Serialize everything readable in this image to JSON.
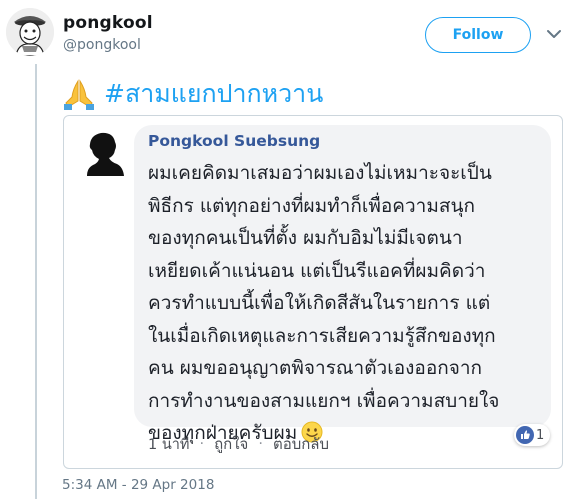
{
  "author": {
    "display_name": "pongkool",
    "handle": "@pongkool"
  },
  "follow_button": {
    "label": "Follow"
  },
  "tweet": {
    "emoji_icon": "folded-hands-icon",
    "hashtag": "#สามแยกปากหวาน"
  },
  "embedded_comment": {
    "author": "Pongkool Suebsung",
    "lines": [
      "ผมเคยคิดมาเสมอว่าผมเองไม่เหมาะจะเป็น",
      "พิธีกร แต่ทุกอย่างที่ผมทำก็เพื่อความสนุก",
      "ของทุกคนเป็นที่ตั้ง ผมกับอิมไม่มีเจตนา",
      "เหยียดเค้าแน่นอน แต่เป็นรีแอคที่ผมคิดว่า",
      "ควรทำแบบนี้เพื่อให้เกิดสีสันในรายการ แต่",
      "ในเมื่อเกิดเหตุและการเสียความรู้สึกของทุก",
      "คน ผมขออนุญาตพิจารณาตัวเองออกจาก",
      "การทำงานของสามแยกฯ เพื่อความสบายใจ",
      "ของทุกฝ่ายครับผม"
    ],
    "emoji": "smile-icon",
    "time_ago": "1 นาที",
    "like_label": "ถูกใจ",
    "reply_label": "ตอบกลับ",
    "reaction_count": "1",
    "reaction_color": "#4267b2"
  },
  "timestamp": "5:34 AM - 29 Apr 2018",
  "colors": {
    "accent": "#1da1f2",
    "fb_name": "#365899",
    "bubble": "#f2f3f5"
  }
}
